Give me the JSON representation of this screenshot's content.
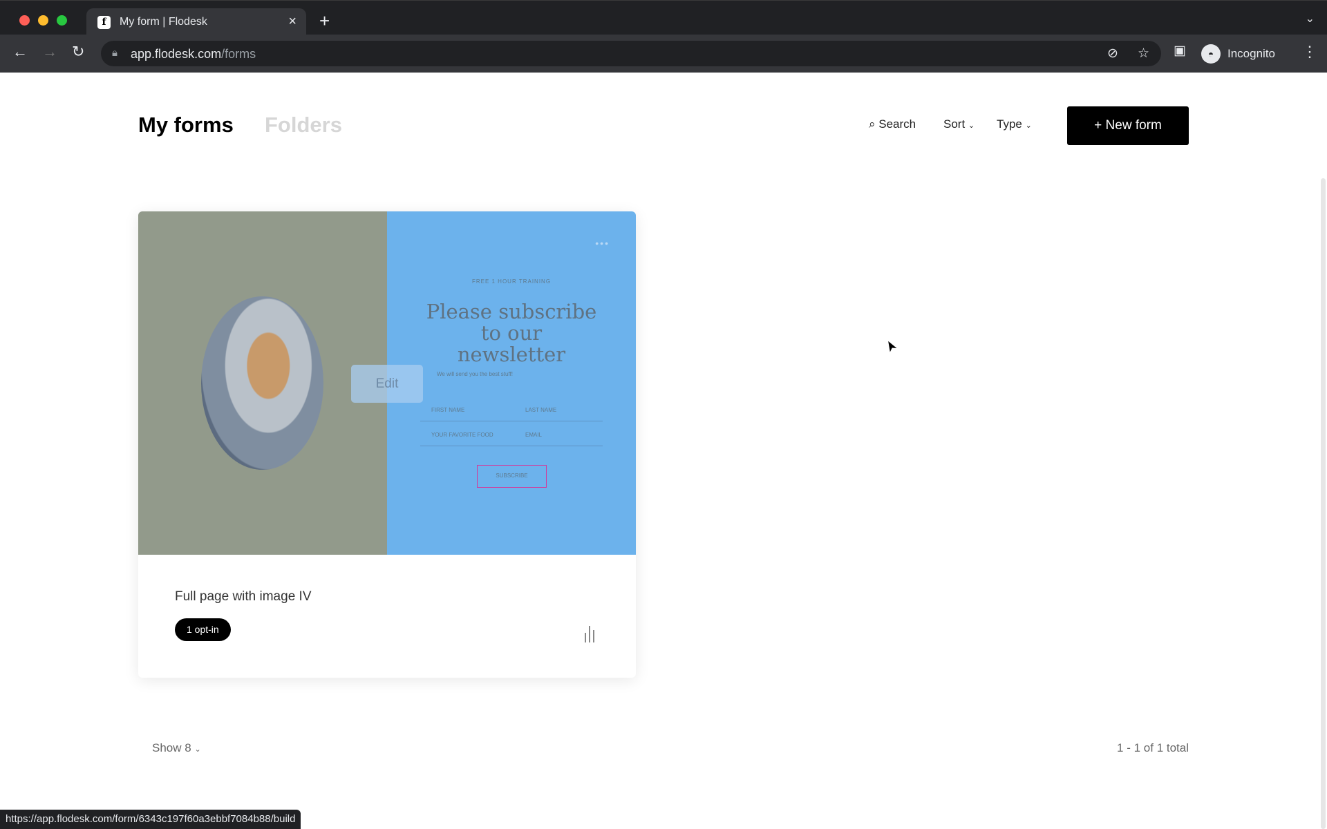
{
  "browser": {
    "tab_title": "My form | Flodesk",
    "url_host": "app.flodesk.com",
    "url_path": "/forms",
    "profile": "Incognito",
    "status_url": "https://app.flodesk.com/form/6343c197f60a3ebbf7084b88/build"
  },
  "header": {
    "title": "My forms",
    "folders": "Folders",
    "search": "Search",
    "sort": "Sort",
    "type": "Type",
    "new_form": "+ New form"
  },
  "card": {
    "name": "Full page with image IV",
    "badge": "1 opt-in",
    "edit": "Edit",
    "preview": {
      "kicker": "FREE 1 HOUR TRAINING",
      "heading": "Please subscribe to our newsletter",
      "subtext": "We will send you the best stuff!",
      "first_name": "FIRST NAME",
      "last_name": "LAST NAME",
      "food": "YOUR FAVORITE FOOD",
      "email": "EMAIL",
      "button": "SUBSCRIBE",
      "left_color": "#929a8b",
      "right_color": "#6cb2ec"
    }
  },
  "footer": {
    "show": "Show 8",
    "pagination": "1 - 1 of 1 total"
  }
}
